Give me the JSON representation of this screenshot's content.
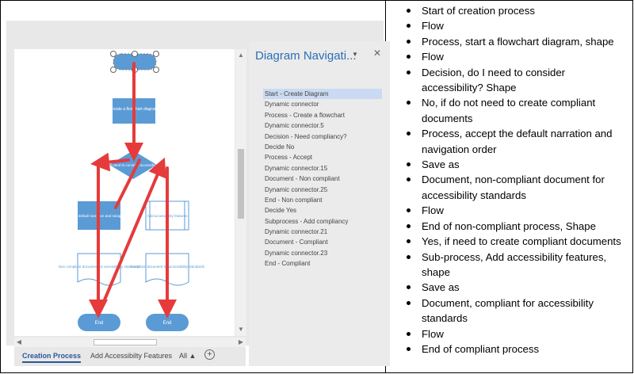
{
  "diagram": {
    "start_label": "",
    "process_label": "Create a flowchart diagram",
    "decision_label": "Do I need to consider accessibility?",
    "accept_label": "Accept the default narration and navigation order",
    "add_features_label": "Add accessibility features",
    "noncompliant_label": "Non compliant document for accessibility standards",
    "compliant_label": "Compliant document for accessibility standards",
    "end_left_label": "End",
    "end_right_label": "End",
    "colors": {
      "shape_fill": "#5b9bd5",
      "document_fill": "#ffffff",
      "arrow": "#e53b3b"
    }
  },
  "navigation": {
    "title": "Diagram Navigati...",
    "dropdown_icon": "chevron-down-icon",
    "close_icon": "close-icon",
    "items": [
      {
        "label": "Start - Create Diagram",
        "selected": true
      },
      {
        "label": "Dynamic connector",
        "selected": false
      },
      {
        "label": "Process - Create a flowchart",
        "selected": false
      },
      {
        "label": "Dynamic connector.5",
        "selected": false
      },
      {
        "label": "Decision - Need compliancy?",
        "selected": false
      },
      {
        "label": "Decide No",
        "selected": false
      },
      {
        "label": "Process - Accept",
        "selected": false
      },
      {
        "label": "Dynamic connector.15",
        "selected": false
      },
      {
        "label": "Document - Non compliant",
        "selected": false
      },
      {
        "label": "Dynamic connector.25",
        "selected": false
      },
      {
        "label": "End - Non compliant",
        "selected": false
      },
      {
        "label": "Decide Yes",
        "selected": false
      },
      {
        "label": "Subprocess - Add compliancy",
        "selected": false
      },
      {
        "label": "Dynamic connector.21",
        "selected": false
      },
      {
        "label": "Document - Compliant",
        "selected": false
      },
      {
        "label": "Dynamic connector.23",
        "selected": false
      },
      {
        "label": "End - Compliant",
        "selected": false
      }
    ]
  },
  "tabs": {
    "creation": "Creation Process",
    "features": "Add Accessibilty Features",
    "all": "All ▲",
    "add": "+"
  },
  "scroll": {
    "up": "▲",
    "down": "▼",
    "left": "◀",
    "right": "▶"
  },
  "bullets": [
    "Start of creation process",
    "Flow",
    "Process, start a flowchart diagram, shape",
    "Flow",
    "Decision, do I need to consider accessibility? Shape",
    "No, if do not need to create compliant documents",
    "Process, accept the default narration and navigation order",
    "Save as",
    "Document, non-compliant document for accessibility standards",
    "Flow",
    "End of non-compliant process, Shape",
    "Yes, if need to create compliant documents",
    "Sub-process, Add accessibility features, shape",
    "Save as",
    "Document, compliant for accessibility standards",
    "Flow",
    "End of compliant process"
  ]
}
